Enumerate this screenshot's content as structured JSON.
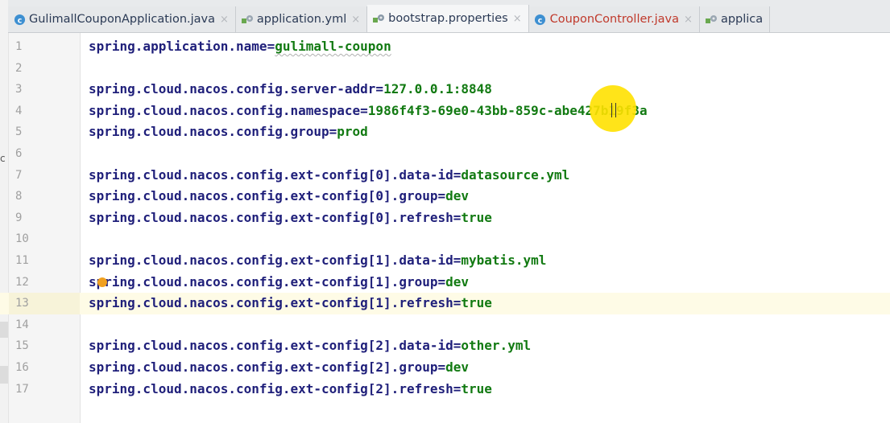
{
  "tabs": [
    {
      "label": "GulimallCouponApplication.java",
      "icon": "class-c-icon",
      "active": false,
      "color": "#2b3a55"
    },
    {
      "label": "application.yml",
      "icon": "yml-config-icon",
      "active": false,
      "color": "#2b3a55"
    },
    {
      "label": "bootstrap.properties",
      "icon": "properties-config-icon",
      "active": true,
      "color": "#2b3a55"
    },
    {
      "label": "CouponController.java",
      "icon": "class-c-icon",
      "active": false,
      "color": "#c0392b"
    },
    {
      "label": "applica",
      "icon": "yml-config-icon",
      "active": false,
      "color": "#2b3a55"
    }
  ],
  "tab_close_glyph": "×",
  "side_fragment": "c",
  "editor": {
    "current_line": 13,
    "lines": [
      {
        "num": "1",
        "key": "spring.application.name",
        "eq": "=",
        "value": "gulimall-coupon"
      },
      {
        "num": "2",
        "key": "",
        "eq": "",
        "value": ""
      },
      {
        "num": "3",
        "key": "spring.cloud.nacos.config.server-addr",
        "eq": "=",
        "value": "127.0.0.1:8848"
      },
      {
        "num": "4",
        "key": "spring.cloud.nacos.config.namespace",
        "eq": "=",
        "value": "1986f4f3-69e0-43bb-859c-abe427b19f3a"
      },
      {
        "num": "5",
        "key": "spring.cloud.nacos.config.group",
        "eq": "=",
        "value": "prod"
      },
      {
        "num": "6",
        "key": "",
        "eq": "",
        "value": ""
      },
      {
        "num": "7",
        "key": "spring.cloud.nacos.config.ext-config[0].data-id",
        "eq": "=",
        "value": "datasource.yml"
      },
      {
        "num": "8",
        "key": "spring.cloud.nacos.config.ext-config[0].group",
        "eq": "=",
        "value": "dev"
      },
      {
        "num": "9",
        "key": "spring.cloud.nacos.config.ext-config[0].refresh",
        "eq": "=",
        "value": "true"
      },
      {
        "num": "10",
        "key": "",
        "eq": "",
        "value": ""
      },
      {
        "num": "11",
        "key": "spring.cloud.nacos.config.ext-config[1].data-id",
        "eq": "=",
        "value": "mybatis.yml"
      },
      {
        "num": "12",
        "key": "spring.cloud.nacos.config.ext-config[1].group",
        "eq": "=",
        "value": "dev"
      },
      {
        "num": "13",
        "key": "spring.cloud.nacos.config.ext-config[1].refresh",
        "eq": "=",
        "value": "true"
      },
      {
        "num": "14",
        "key": "",
        "eq": "",
        "value": ""
      },
      {
        "num": "15",
        "key": "spring.cloud.nacos.config.ext-config[2].data-id",
        "eq": "=",
        "value": "other.yml"
      },
      {
        "num": "16",
        "key": "spring.cloud.nacos.config.ext-config[2].group",
        "eq": "=",
        "value": "dev"
      },
      {
        "num": "17",
        "key": "spring.cloud.nacos.config.ext-config[2].refresh",
        "eq": "=",
        "value": "true"
      }
    ]
  },
  "colors": {
    "key": "#1f1f7a",
    "value": "#127a12",
    "line_number": "#a0a0a0",
    "current_line_bg": "#fefbe6",
    "cursor_highlight": "#ffe100",
    "tab_bar_bg": "#e8eaec"
  }
}
